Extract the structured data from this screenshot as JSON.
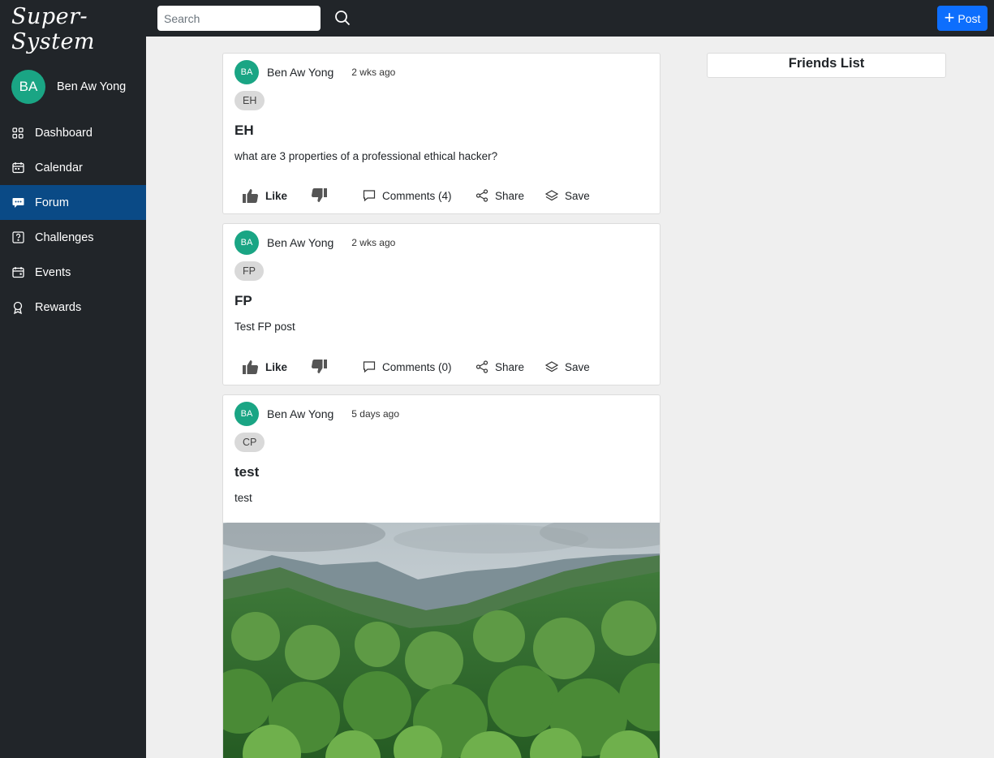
{
  "app": {
    "brand": "Super-System"
  },
  "user": {
    "initials": "BA",
    "name": "Ben Aw Yong"
  },
  "sidebar": {
    "items": [
      {
        "label": "Dashboard",
        "icon": "grid-icon"
      },
      {
        "label": "Calendar",
        "icon": "calendar-icon"
      },
      {
        "label": "Forum",
        "icon": "chat-icon",
        "active": true
      },
      {
        "label": "Challenges",
        "icon": "question-square-icon"
      },
      {
        "label": "Events",
        "icon": "calendar-event-icon"
      },
      {
        "label": "Rewards",
        "icon": "award-icon"
      }
    ]
  },
  "topbar": {
    "search_placeholder": "Search",
    "post_label": "Post",
    "accent": "#0d6efd"
  },
  "posts": [
    {
      "author_initials": "BA",
      "author": "Ben Aw Yong",
      "time": "2 wks ago",
      "tag": "EH",
      "title": "EH",
      "body": "what are 3 properties of a professional ethical hacker?",
      "like_label": "Like",
      "comments_label": "Comments (4)",
      "share_label": "Share",
      "save_label": "Save"
    },
    {
      "author_initials": "BA",
      "author": "Ben Aw Yong",
      "time": "2 wks ago",
      "tag": "FP",
      "title": "FP",
      "body": "Test FP post",
      "like_label": "Like",
      "comments_label": "Comments (0)",
      "share_label": "Share",
      "save_label": "Save"
    },
    {
      "author_initials": "BA",
      "author": "Ben Aw Yong",
      "time": "5 days ago",
      "tag": "CP",
      "title": "test",
      "body": "test"
    }
  ],
  "friends": {
    "title": "Friends List"
  },
  "colors": {
    "sidebar_bg": "#212529",
    "active_nav": "#0a4a86",
    "avatar": "#1aa584"
  }
}
